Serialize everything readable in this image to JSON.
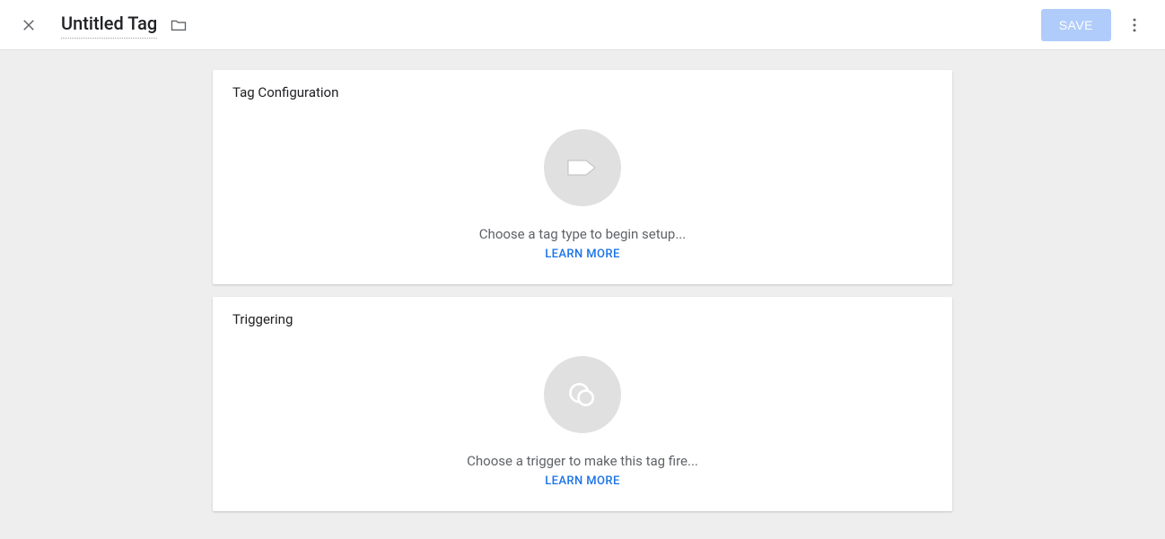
{
  "header": {
    "title": "Untitled Tag",
    "save_label": "SAVE"
  },
  "tag_config": {
    "heading": "Tag Configuration",
    "hint": "Choose a tag type to begin setup...",
    "learn_more": "LEARN MORE"
  },
  "triggering": {
    "heading": "Triggering",
    "hint": "Choose a trigger to make this tag fire...",
    "learn_more": "LEARN MORE"
  }
}
